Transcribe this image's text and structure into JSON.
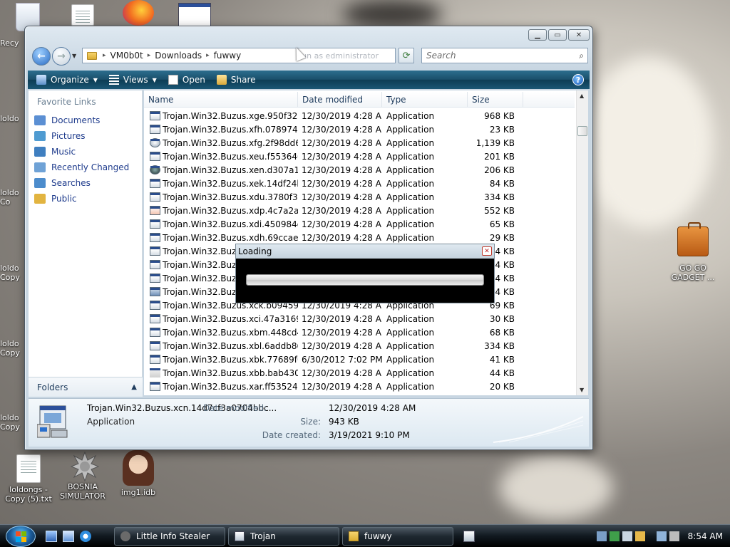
{
  "desktop": {
    "icons": [
      {
        "label": "loldongs - Copy (5).txt"
      },
      {
        "label": "BOSNIA SIMULATOR"
      },
      {
        "label": "img1.idb"
      },
      {
        "label": "GO GO GADGET ..."
      }
    ],
    "edge_labels": [
      "Recy",
      "loldo",
      "loldo Co",
      "loldo Copy",
      "loldo Copy",
      "loldo Copy"
    ]
  },
  "window": {
    "address": {
      "crumbs": [
        "VM0b0t",
        "Downloads",
        "fuwwy"
      ],
      "hint": "Run as edministrator"
    },
    "search_placeholder": "Search",
    "toolbar": {
      "organize": "Organize",
      "views": "Views",
      "open": "Open",
      "share": "Share"
    },
    "nav": {
      "heading": "Favorite Links",
      "items": [
        {
          "label": "Documents",
          "color": "#5b8fd3"
        },
        {
          "label": "Pictures",
          "color": "#4f9bd1"
        },
        {
          "label": "Music",
          "color": "#3f7fc0"
        },
        {
          "label": "Recently Changed",
          "color": "#6fa2d6"
        },
        {
          "label": "Searches",
          "color": "#4c8ccc"
        },
        {
          "label": "Public",
          "color": "#e2b440"
        }
      ],
      "folders_label": "Folders"
    },
    "columns": [
      "Name",
      "Date modified",
      "Type",
      "Size"
    ],
    "files": [
      {
        "name": "Trojan.Win32.Buzus.xge.950f328b...",
        "date": "12/30/2019 4:28 AM",
        "type": "Application",
        "size": "968 KB"
      },
      {
        "name": "Trojan.Win32.Buzus.xfh.0789742a...",
        "date": "12/30/2019 4:28 AM",
        "type": "Application",
        "size": "23 KB"
      },
      {
        "name": "Trojan.Win32.Buzus.xfg.2f98dd69...",
        "date": "12/30/2019 4:28 AM",
        "type": "Application",
        "size": "1,139 KB"
      },
      {
        "name": "Trojan.Win32.Buzus.xeu.f5536401...",
        "date": "12/30/2019 4:28 AM",
        "type": "Application",
        "size": "201 KB"
      },
      {
        "name": "Trojan.Win32.Buzus.xen.d307a119...",
        "date": "12/30/2019 4:28 AM",
        "type": "Application",
        "size": "206 KB"
      },
      {
        "name": "Trojan.Win32.Buzus.xek.14df24b7...",
        "date": "12/30/2019 4:28 AM",
        "type": "Application",
        "size": "84 KB"
      },
      {
        "name": "Trojan.Win32.Buzus.xdu.3780f302...",
        "date": "12/30/2019 4:28 AM",
        "type": "Application",
        "size": "334 KB"
      },
      {
        "name": "Trojan.Win32.Buzus.xdp.4c7a2acb...",
        "date": "12/30/2019 4:28 AM",
        "type": "Application",
        "size": "552 KB"
      },
      {
        "name": "Trojan.Win32.Buzus.xdi.450984d1...",
        "date": "12/30/2019 4:28 AM",
        "type": "Application",
        "size": "65 KB"
      },
      {
        "name": "Trojan.Win32.Buzus.xdh.69ccae0b...",
        "date": "12/30/2019 4:28 AM",
        "type": "Application",
        "size": "29 KB"
      },
      {
        "name": "Trojan.Win32.Buzus",
        "date": "",
        "type": "",
        "size": "84 KB"
      },
      {
        "name": "Trojan.Win32.Buzus",
        "date": "",
        "type": "",
        "size": "334 KB"
      },
      {
        "name": "Trojan.Win32.Buzus",
        "date": "",
        "type": "",
        "size": "114 KB"
      },
      {
        "name": "Trojan.Win32.Buzus",
        "date": "",
        "type": "",
        "size": "944 KB"
      },
      {
        "name": "Trojan.Win32.Buzus.xck.b09459cd...",
        "date": "12/30/2019 4:28 AM",
        "type": "Application",
        "size": "69 KB"
      },
      {
        "name": "Trojan.Win32.Buzus.xci.47a3169b...",
        "date": "12/30/2019 4:28 AM",
        "type": "Application",
        "size": "30 KB"
      },
      {
        "name": "Trojan.Win32.Buzus.xbm.448cd4c...",
        "date": "12/30/2019 4:28 AM",
        "type": "Application",
        "size": "68 KB"
      },
      {
        "name": "Trojan.Win32.Buzus.xbl.6addb861...",
        "date": "12/30/2019 4:28 AM",
        "type": "Application",
        "size": "334 KB"
      },
      {
        "name": "Trojan.Win32.Buzus.xbk.77689f02f...",
        "date": "6/30/2012 7:02 PM",
        "type": "Application",
        "size": "41 KB"
      },
      {
        "name": "Trojan.Win32.Buzus.xbb.bab4301...",
        "date": "12/30/2019 4:28 AM",
        "type": "Application",
        "size": "44 KB"
      },
      {
        "name": "Trojan.Win32.Buzus.xar.ff5352403...",
        "date": "12/30/2019 4:28 AM",
        "type": "Application",
        "size": "20 KB"
      }
    ],
    "details": {
      "name": "Trojan.Win32.Buzus.xcn.14d7cf3a0704bbc...",
      "type": "Application",
      "date_modified_label": "Date modified:",
      "date_modified": "12/30/2019 4:28 AM",
      "size_label": "Size:",
      "size": "943 KB",
      "date_created_label": "Date created:",
      "date_created": "3/19/2021 9:10 PM"
    }
  },
  "dialog": {
    "title": "Loading",
    "progress_fraction": 1.0
  },
  "taskbar": {
    "buttons": [
      "Little Info Stealer",
      "Trojan",
      "fuwwy"
    ],
    "clock": "8:54 AM"
  }
}
